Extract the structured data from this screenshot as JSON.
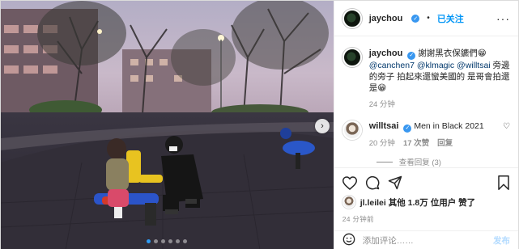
{
  "photo": {
    "description_icon": "playground-photo",
    "carousel_total": 6,
    "carousel_active": 1,
    "next_icon": "chevron-right-icon"
  },
  "header": {
    "username": "jaychou",
    "separator": "•",
    "follow_label": "已关注",
    "more_icon": "more-horizontal-icon"
  },
  "caption": {
    "username": "jaychou",
    "text_before": "謝謝黑衣保鑣們",
    "mention1": "@canchen7",
    "mention2": "@klmagic",
    "mention3": "@willtsai",
    "text_after": "旁邊的旁子 拍起來還蠻美國的 是哥會拍還是",
    "emoji1": "😁",
    "emoji2": "😁",
    "time": "24 分钟"
  },
  "comment": {
    "username": "willtsai",
    "text": "Men in Black 2021",
    "time": "20 分钟",
    "likes": "17 次赞",
    "reply_label": "回复",
    "replies_label": "查看回复 (3)"
  },
  "actions": {
    "like_icon": "heart-icon",
    "comment_icon": "comment-icon",
    "share_icon": "send-icon",
    "save_icon": "bookmark-icon"
  },
  "likes": {
    "user": "jl.leilei",
    "middle": "其他",
    "count": "1.8万",
    "suffix": "位用户 赞了"
  },
  "timestamp": "24 分钟前",
  "add_comment": {
    "emoji_icon": "smiley-icon",
    "placeholder": "添加评论……",
    "post_label": "发布"
  },
  "colors": {
    "accent": "#0095f6",
    "verified": "#3897f0",
    "muted": "#8e8e8e"
  }
}
